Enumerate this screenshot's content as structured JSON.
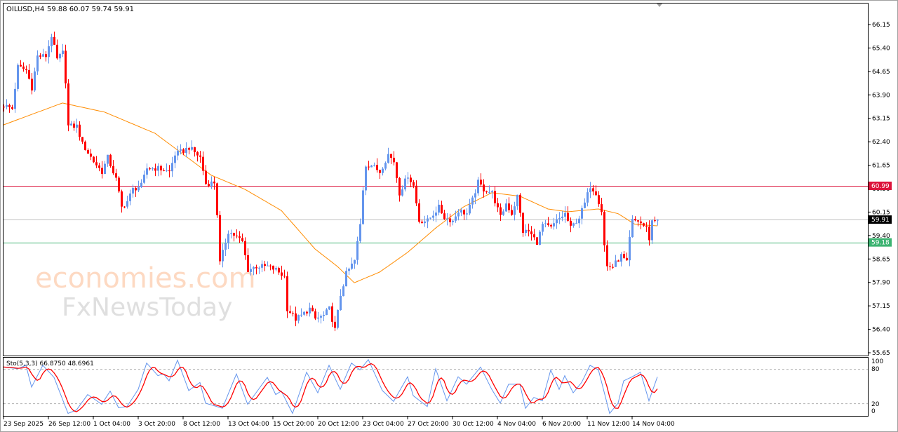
{
  "header": {
    "symbol_info": "OILUSD,H4",
    "ohlc": "59.88 60.07 59.74 59.91"
  },
  "indicator": {
    "label": "Sto(5,3,3) 66.8750 48.6961"
  },
  "watermark": {
    "line1": "economies.com",
    "line2": "FxNewsToday"
  },
  "colors": {
    "bull": "#6495ED",
    "bear": "#FF0000",
    "ma": "#FF8C00",
    "resistance": "#DC143C",
    "current": "#C0C0C0",
    "support": "#3CB371",
    "stoch_main": "#6495ED",
    "stoch_signal": "#FF0000"
  },
  "chart_data": [
    {
      "type": "candlestick",
      "title": "OILUSD, H4",
      "ylim": [
        55.65,
        66.15
      ],
      "y_ticks": [
        "66.15",
        "65.40",
        "64.65",
        "63.90",
        "63.15",
        "62.40",
        "61.65",
        "60.90",
        "60.15",
        "59.40",
        "58.65",
        "57.90",
        "57.15",
        "56.40",
        "55.65"
      ],
      "x_tick_labels": [
        "23 Sep 2025",
        "26 Sep 12:00",
        "1 Oct 04:00",
        "3 Oct 20:00",
        "8 Oct 12:00",
        "13 Oct 04:00",
        "15 Oct 20:00",
        "20 Oct 12:00",
        "23 Oct 04:00",
        "27 Oct 20:00",
        "30 Oct 12:00",
        "4 Nov 04:00",
        "6 Nov 20:00",
        "11 Nov 12:00",
        "14 Nov 04:00"
      ],
      "bars_per_x_tick": 16,
      "candle_count": 234,
      "close_waypoints": [
        [
          0,
          63.57
        ],
        [
          3,
          63.46
        ],
        [
          5,
          64.8
        ],
        [
          8,
          64.69
        ],
        [
          10,
          64.13
        ],
        [
          12,
          65.14
        ],
        [
          15,
          65.14
        ],
        [
          17,
          65.8
        ],
        [
          19,
          65.03
        ],
        [
          21,
          65.25
        ],
        [
          22,
          64.35
        ],
        [
          23,
          62.9
        ],
        [
          26,
          62.9
        ],
        [
          28,
          62.33
        ],
        [
          32,
          61.77
        ],
        [
          35,
          61.44
        ],
        [
          37,
          61.9
        ],
        [
          40,
          61.2
        ],
        [
          42,
          60.3
        ],
        [
          44,
          60.5
        ],
        [
          46,
          60.88
        ],
        [
          49,
          61.0
        ],
        [
          51,
          61.55
        ],
        [
          55,
          61.55
        ],
        [
          59,
          61.44
        ],
        [
          61,
          62.0
        ],
        [
          64,
          62.11
        ],
        [
          66,
          62.22
        ],
        [
          70,
          61.9
        ],
        [
          72,
          61.06
        ],
        [
          75,
          61.1
        ],
        [
          76,
          60.1
        ],
        [
          77,
          58.52
        ],
        [
          80,
          59.53
        ],
        [
          82,
          59.42
        ],
        [
          85,
          59.2
        ],
        [
          87,
          58.3
        ],
        [
          90,
          58.41
        ],
        [
          94,
          58.41
        ],
        [
          97,
          58.3
        ],
        [
          100,
          58.08
        ],
        [
          101,
          57.06
        ],
        [
          104,
          56.73
        ],
        [
          106,
          56.84
        ],
        [
          109,
          57.06
        ],
        [
          111,
          56.73
        ],
        [
          114,
          56.84
        ],
        [
          116,
          57.06
        ],
        [
          118,
          56.39
        ],
        [
          120,
          57.5
        ],
        [
          122,
          58.18
        ],
        [
          125,
          58.6
        ],
        [
          127,
          59.75
        ],
        [
          128,
          60.88
        ],
        [
          129,
          61.66
        ],
        [
          131,
          61.66
        ],
        [
          134,
          61.44
        ],
        [
          137,
          62.0
        ],
        [
          139,
          61.77
        ],
        [
          141,
          60.76
        ],
        [
          144,
          61.33
        ],
        [
          146,
          60.99
        ],
        [
          148,
          59.87
        ],
        [
          151,
          59.87
        ],
        [
          155,
          60.3
        ],
        [
          157,
          59.98
        ],
        [
          160,
          59.87
        ],
        [
          162,
          60.2
        ],
        [
          165,
          60.1
        ],
        [
          167,
          60.54
        ],
        [
          169,
          61.1
        ],
        [
          171,
          60.88
        ],
        [
          174,
          60.77
        ],
        [
          177,
          59.98
        ],
        [
          179,
          60.43
        ],
        [
          181,
          60.1
        ],
        [
          183,
          60.66
        ],
        [
          185,
          59.53
        ],
        [
          187,
          59.53
        ],
        [
          190,
          59.19
        ],
        [
          192,
          59.75
        ],
        [
          195,
          59.64
        ],
        [
          197,
          59.87
        ],
        [
          200,
          60.1
        ],
        [
          202,
          59.64
        ],
        [
          205,
          59.98
        ],
        [
          207,
          60.43
        ],
        [
          209,
          60.99
        ],
        [
          211,
          60.77
        ],
        [
          213,
          60.2
        ],
        [
          214,
          59.08
        ],
        [
          215,
          58.41
        ],
        [
          217,
          58.41
        ],
        [
          220,
          58.75
        ],
        [
          222,
          58.52
        ],
        [
          223,
          59.3
        ],
        [
          224,
          59.87
        ],
        [
          226,
          59.87
        ],
        [
          229,
          59.64
        ],
        [
          230,
          59.3
        ],
        [
          231,
          59.87
        ],
        [
          233,
          59.91
        ]
      ],
      "moving_average_waypoints": [
        [
          0,
          62.94
        ],
        [
          21,
          63.64
        ],
        [
          36,
          63.35
        ],
        [
          54,
          62.67
        ],
        [
          64,
          62.0
        ],
        [
          74,
          61.33
        ],
        [
          86,
          60.88
        ],
        [
          99,
          60.2
        ],
        [
          111,
          58.97
        ],
        [
          119,
          58.41
        ],
        [
          125,
          57.89
        ],
        [
          134,
          58.23
        ],
        [
          144,
          58.86
        ],
        [
          154,
          59.64
        ],
        [
          164,
          60.32
        ],
        [
          174,
          60.77
        ],
        [
          184,
          60.66
        ],
        [
          194,
          60.25
        ],
        [
          201,
          60.16
        ],
        [
          212,
          60.25
        ],
        [
          219,
          60.1
        ],
        [
          225,
          59.76
        ],
        [
          233,
          59.71
        ]
      ],
      "horizontal_lines": [
        {
          "label": "60.99",
          "value": 60.99,
          "role": "resistance"
        },
        {
          "label": "59.91",
          "value": 59.91,
          "role": "current"
        },
        {
          "label": "59.18",
          "value": 59.18,
          "role": "support"
        }
      ]
    },
    {
      "type": "line",
      "title": "Sto(5,3,3)",
      "ylim": [
        0,
        100
      ],
      "y_ticks": [
        "100",
        "80",
        "20",
        "0"
      ],
      "levels": [
        80,
        20
      ],
      "k_waypoints": [
        [
          0,
          84
        ],
        [
          5,
          81
        ],
        [
          8,
          87
        ],
        [
          10,
          49
        ],
        [
          14,
          87
        ],
        [
          18,
          66
        ],
        [
          23,
          3
        ],
        [
          26,
          9
        ],
        [
          30,
          36
        ],
        [
          35,
          19
        ],
        [
          38,
          42
        ],
        [
          41,
          13
        ],
        [
          44,
          15
        ],
        [
          48,
          45
        ],
        [
          51,
          91
        ],
        [
          55,
          69
        ],
        [
          57,
          72
        ],
        [
          59,
          60
        ],
        [
          62,
          96
        ],
        [
          66,
          43
        ],
        [
          70,
          57
        ],
        [
          72,
          21
        ],
        [
          78,
          12
        ],
        [
          83,
          72
        ],
        [
          87,
          19
        ],
        [
          94,
          66
        ],
        [
          97,
          36
        ],
        [
          99,
          42
        ],
        [
          103,
          3
        ],
        [
          108,
          75
        ],
        [
          112,
          39
        ],
        [
          116,
          87
        ],
        [
          120,
          45
        ],
        [
          124,
          91
        ],
        [
          127,
          79
        ],
        [
          130,
          97
        ],
        [
          135,
          43
        ],
        [
          139,
          24
        ],
        [
          144,
          67
        ],
        [
          146,
          34
        ],
        [
          151,
          15
        ],
        [
          154,
          81
        ],
        [
          158,
          25
        ],
        [
          162,
          67
        ],
        [
          165,
          54
        ],
        [
          170,
          84
        ],
        [
          174,
          45
        ],
        [
          177,
          21
        ],
        [
          180,
          54
        ],
        [
          184,
          54
        ],
        [
          186,
          12
        ],
        [
          189,
          31
        ],
        [
          192,
          25
        ],
        [
          195,
          79
        ],
        [
          198,
          45
        ],
        [
          200,
          69
        ],
        [
          203,
          39
        ],
        [
          206,
          57
        ],
        [
          209,
          87
        ],
        [
          212,
          79
        ],
        [
          216,
          3
        ],
        [
          219,
          21
        ],
        [
          221,
          60
        ],
        [
          224,
          67
        ],
        [
          227,
          75
        ],
        [
          230,
          25
        ],
        [
          233,
          66.875
        ]
      ],
      "last_k": 66.875,
      "last_d": 48.6961
    }
  ]
}
